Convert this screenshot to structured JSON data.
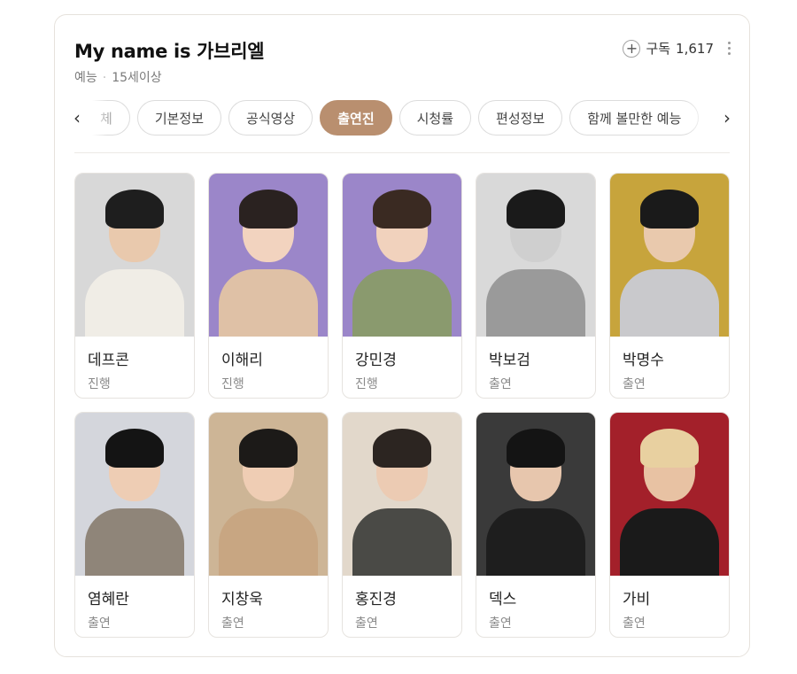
{
  "header": {
    "title": "My name is 가브리엘",
    "genre": "예능",
    "rating": "15세이상",
    "subscribe_label": "구독",
    "subscribe_count": "1,617"
  },
  "tabs": [
    {
      "label": "체",
      "active": false
    },
    {
      "label": "기본정보",
      "active": false
    },
    {
      "label": "공식영상",
      "active": false
    },
    {
      "label": "출연진",
      "active": true
    },
    {
      "label": "시청률",
      "active": false
    },
    {
      "label": "편성정보",
      "active": false
    },
    {
      "label": "함께 볼만한 예능",
      "active": false
    }
  ],
  "icons": {
    "left": "chevron-left-icon",
    "right": "chevron-right-icon",
    "subscribe": "plus-circle-icon",
    "more": "more-vertical-icon"
  },
  "cast": [
    {
      "name": "데프콘",
      "role": "진행",
      "bg": "#d8d8d8",
      "skin": "#e9c9ad",
      "hair": "#1e1e1e",
      "top": "#f0ede6"
    },
    {
      "name": "이해리",
      "role": "진행",
      "bg": "#9b86c9",
      "skin": "#f2d3bf",
      "hair": "#2a2220",
      "top": "#dfc1a6"
    },
    {
      "name": "강민경",
      "role": "진행",
      "bg": "#9b86c9",
      "skin": "#f1d2bd",
      "hair": "#3a2a22",
      "top": "#8a9a6e"
    },
    {
      "name": "박보검",
      "role": "출연",
      "bg": "#d9d9d9",
      "skin": "#cfcfcf",
      "hair": "#1a1a1a",
      "top": "#9a9a9a"
    },
    {
      "name": "박명수",
      "role": "출연",
      "bg": "#c7a43c",
      "skin": "#e9c9ad",
      "hair": "#1a1a1a",
      "top": "#c9c9cc"
    },
    {
      "name": "염혜란",
      "role": "출연",
      "bg": "#d4d6dc",
      "skin": "#eecdb4",
      "hair": "#141414",
      "top": "#8f8579"
    },
    {
      "name": "지창욱",
      "role": "출연",
      "bg": "#cdb596",
      "skin": "#efcdb4",
      "hair": "#1c1a18",
      "top": "#c8a682"
    },
    {
      "name": "홍진경",
      "role": "출연",
      "bg": "#e2d8cb",
      "skin": "#eccbb3",
      "hair": "#2c2521",
      "top": "#4a4a46"
    },
    {
      "name": "덱스",
      "role": "출연",
      "bg": "#3a3a3a",
      "skin": "#e7c6ad",
      "hair": "#141414",
      "top": "#1e1e1e"
    },
    {
      "name": "가비",
      "role": "출연",
      "bg": "#a3202a",
      "skin": "#e8c2a3",
      "hair": "#e8d0a0",
      "top": "#1a1a1a"
    }
  ]
}
